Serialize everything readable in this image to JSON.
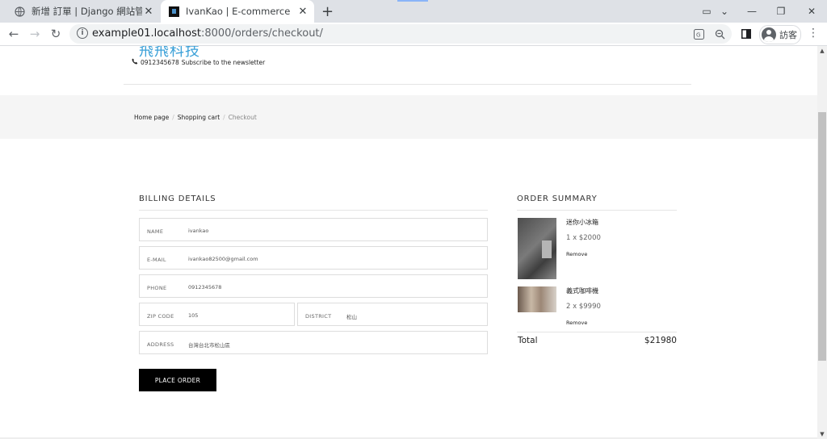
{
  "browser": {
    "tabs": [
      {
        "title": "新增 訂單 | Django 網站管理",
        "close": "✕",
        "active": false
      },
      {
        "title": "IvanKao | E-commerce",
        "close": "✕",
        "active": true
      }
    ],
    "new_tab": "+",
    "url_host": "example01.localhost",
    "url_rest": ":8000/orders/checkout/",
    "profile_label": "訪客",
    "window_controls": {
      "minimize": "—",
      "restore": "❐",
      "close": "✕"
    }
  },
  "site": {
    "logo_text": "飛飛科技",
    "phone": "0912345678",
    "newsletter": "Subscribe to the newsletter"
  },
  "breadcrumb": {
    "home": "Home page",
    "cart": "Shopping cart",
    "current": "Checkout",
    "separator": "/"
  },
  "billing": {
    "title": "BILLING DETAILS",
    "fields": {
      "name": {
        "label": "NAME",
        "value": "ivankao"
      },
      "email": {
        "label": "E-MAIL",
        "value": "ivankao82500@gmail.com"
      },
      "phone": {
        "label": "PHONE",
        "value": "0912345678"
      },
      "zip": {
        "label": "ZIP CODE",
        "value": "105"
      },
      "district": {
        "label": "DISTRICT",
        "value": "松山"
      },
      "address": {
        "label": "ADDRESS",
        "value": "台灣台北市松山區"
      }
    },
    "submit_label": "PLACE ORDER"
  },
  "summary": {
    "title": "ORDER SUMMARY",
    "items": [
      {
        "name": "迷你小冰箱",
        "qty_price": "1 x $2000",
        "remove": "Remove"
      },
      {
        "name": "義式咖啡機",
        "qty_price": "2 x $9990",
        "remove": "Remove"
      }
    ],
    "total_label": "Total",
    "total_value": "$21980"
  },
  "colors": {
    "logo": "#3aa0d8",
    "button_bg": "#000000",
    "band_bg": "#f5f5f5"
  }
}
